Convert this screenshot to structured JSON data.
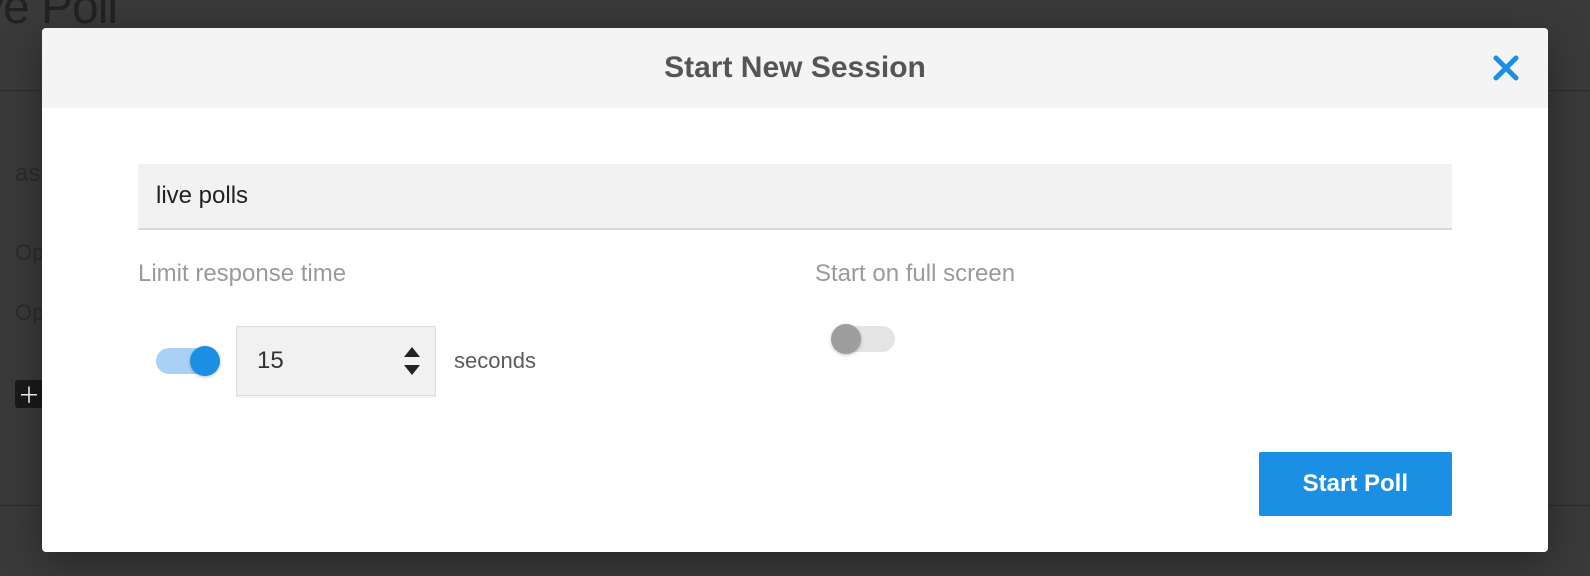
{
  "background": {
    "page_title_fragment": "ve Poll",
    "row_label_fragment": "as",
    "option_fragment_1": "Op",
    "option_fragment_2": "Op"
  },
  "modal": {
    "title": "Start New Session",
    "session_name_value": "live polls",
    "options": {
      "limit_time": {
        "label": "Limit response time",
        "enabled": true,
        "value": "15",
        "unit": "seconds"
      },
      "fullscreen": {
        "label": "Start on full screen",
        "enabled": false
      }
    },
    "actions": {
      "start_label": "Start Poll"
    }
  },
  "colors": {
    "accent": "#1a8fe3"
  }
}
